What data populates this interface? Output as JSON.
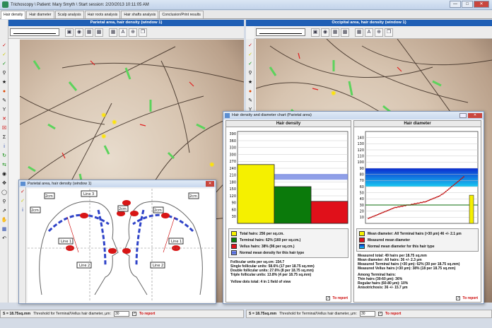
{
  "app": {
    "title": "Trichoscopy  \\ Patient: Mary Smyth \\ Start session: 2/20/2013 10:11:05 AM"
  },
  "tabs": [
    "Hair density",
    "Hair diameter",
    "Scalp analysis",
    "Hair roots analysis",
    "Hair shafts analysis",
    "Conclusion/Print results"
  ],
  "left_panel": {
    "title": "Parietal area, hair density (window 1)"
  },
  "right_panel": {
    "title": "Occipital area, hair density (window 1)"
  },
  "status": {
    "scale": "S = 18.75sq.mm",
    "threshold_label": "Threshold for Terminal/Vellus hair diameter, µm:",
    "threshold_value": "30",
    "to_report": "To report"
  },
  "mini_window": {
    "title": "Parietal area, hair density (window 1)",
    "labels": [
      "2cm",
      "Line 3",
      "2cm",
      "2cm",
      "2cm",
      "2cm",
      "Line 1",
      "Line 2",
      "Line 2",
      "Line 1"
    ]
  },
  "chart_window": {
    "title": "Hair density and diameter chart (Parietal area)",
    "to_report": "To report"
  },
  "chart_data": [
    {
      "type": "bar",
      "title": "Hair density",
      "categories": [
        "Total hairs",
        "Terminal hairs",
        "Vellus hairs"
      ],
      "values": [
        256,
        160,
        96
      ],
      "colors": [
        "#f5f000",
        "#0b7a0b",
        "#e0101a"
      ],
      "ylim": [
        0,
        400
      ],
      "yticks": [
        30,
        60,
        90,
        120,
        150,
        180,
        210,
        240,
        270,
        300,
        330,
        360,
        390
      ],
      "normal_band": [
        190,
        215
      ],
      "legend": [
        {
          "label": "Total hairs: 256 per sq.cm.",
          "color": "#f5f000"
        },
        {
          "label": "Terminal hairs: 62% (160 per sq.cm.)",
          "color": "#0b7a0b"
        },
        {
          "label": "Vellus hairs: 38% (96 per sq.cm.)",
          "color": "#e0101a"
        },
        {
          "label": "Normal mean density for this hair type",
          "color": "#4a63d8"
        }
      ],
      "stats": [
        "Follicular units per sq.cm: 154.7",
        "Single follicular units: 58.6% (17  per 18.75 sq.mm)",
        "Double follicular units: 27.6% (8  per 18.75 sq.mm)",
        "Triple follicular units: 13.8% (4  per 18.75 sq.mm)",
        "",
        "Yellow dots total: 4 in 1 field of view"
      ]
    },
    {
      "type": "line",
      "title": "Hair diameter",
      "ylim": [
        0,
        150
      ],
      "yticks": [
        10,
        20,
        30,
        40,
        50,
        60,
        70,
        80,
        90,
        100,
        110,
        120,
        130,
        140
      ],
      "series": [
        {
          "values": [
            8,
            9,
            10,
            11,
            12,
            13,
            14,
            15,
            16,
            17,
            18,
            19,
            20,
            21,
            22,
            23,
            24,
            25,
            26,
            26,
            27,
            27,
            28,
            28,
            29,
            29,
            30,
            30,
            30,
            31,
            31,
            32,
            32,
            33,
            33,
            34,
            34,
            35,
            35,
            36,
            37,
            38,
            39,
            40,
            41,
            42,
            43,
            44,
            45,
            47,
            48,
            50,
            52,
            54,
            56,
            58,
            60,
            62,
            64,
            66,
            68,
            70,
            72,
            74,
            76
          ]
        }
      ],
      "mean_terminal": 46,
      "measured_mean": 30,
      "normal_band": [
        60,
        90
      ],
      "legend": [
        {
          "label": "Mean diameter: All Terminal hairs (>30 µm) 46 +/- 2.1 µm",
          "color": "#f5f000"
        },
        {
          "label": "Measured mean diameter",
          "color": "#e0101a"
        },
        {
          "label": "Normal mean diameter for this hair type",
          "color": "#2b8fe8"
        }
      ],
      "stats": [
        "Measured total: 49 hairs per 18.75 sq.mm",
        "Mean diameter: All hairs: 36 +/- 2.3 µm",
        "Measured Terminal hairs (>30 µm): 62% (30 per 18.75 sq.mm)",
        "Measured Vellus hairs (<30 µm): 38% (18 per 18.75 sq.mm)",
        "",
        "Among Terminal hairs:",
        "Thin hairs (30-60 µm): 36%",
        "Regular hairs (60-80 µm): 10%",
        "Anisotrichosis: 36 +/- 15.7 µm"
      ]
    }
  ]
}
